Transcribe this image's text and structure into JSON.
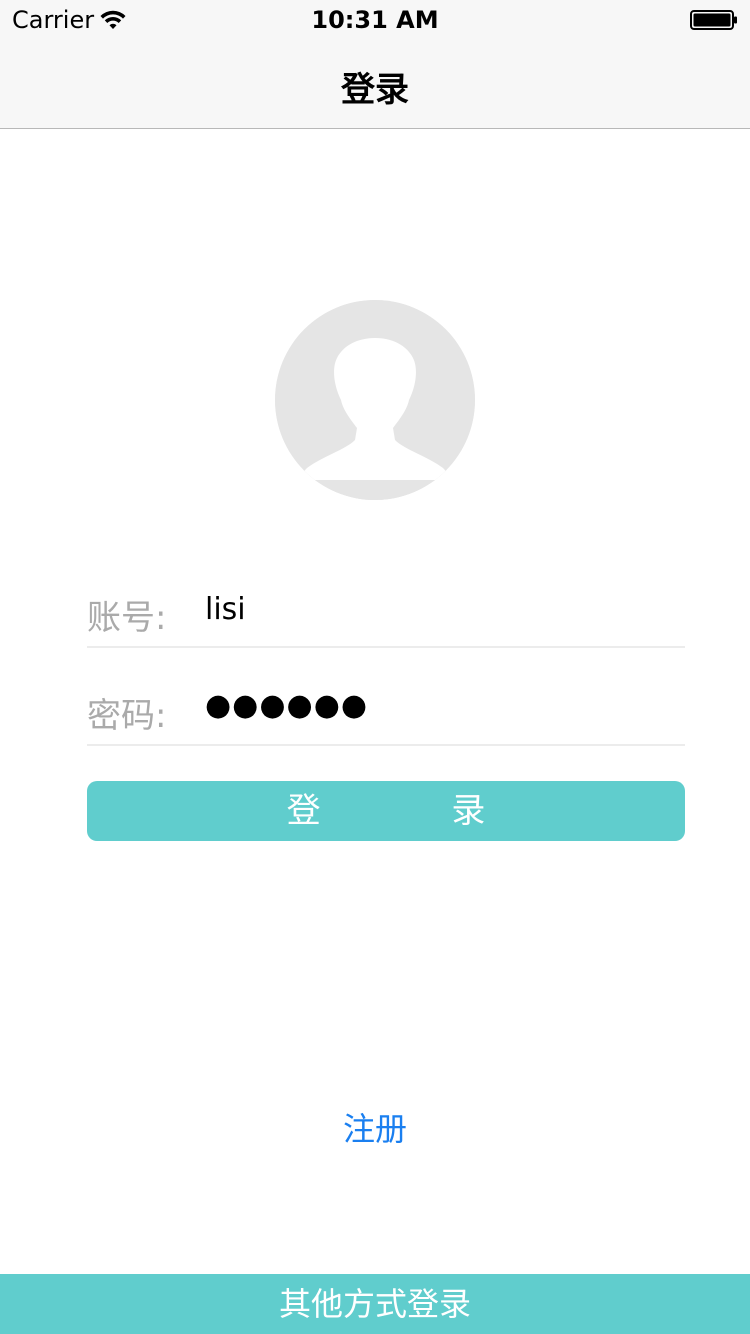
{
  "status_bar": {
    "carrier": "Carrier",
    "time": "10:31 AM",
    "wifi_icon": "wifi-icon",
    "battery_icon": "battery-icon"
  },
  "nav": {
    "title": "登录"
  },
  "avatar": {
    "icon": "user-placeholder-icon"
  },
  "form": {
    "account_label": "账号:",
    "account_value": "lisi",
    "password_label": "密码:",
    "password_value": "●●●●●●"
  },
  "login_button": {
    "label": "登 录"
  },
  "register_link": {
    "label": "注册"
  },
  "other_login": {
    "label": "其他方式登录"
  },
  "colors": {
    "accent": "#60cdcd",
    "link": "#1a7ff0",
    "label_gray": "#aaaaaa",
    "avatar_bg": "#e5e5e5"
  }
}
